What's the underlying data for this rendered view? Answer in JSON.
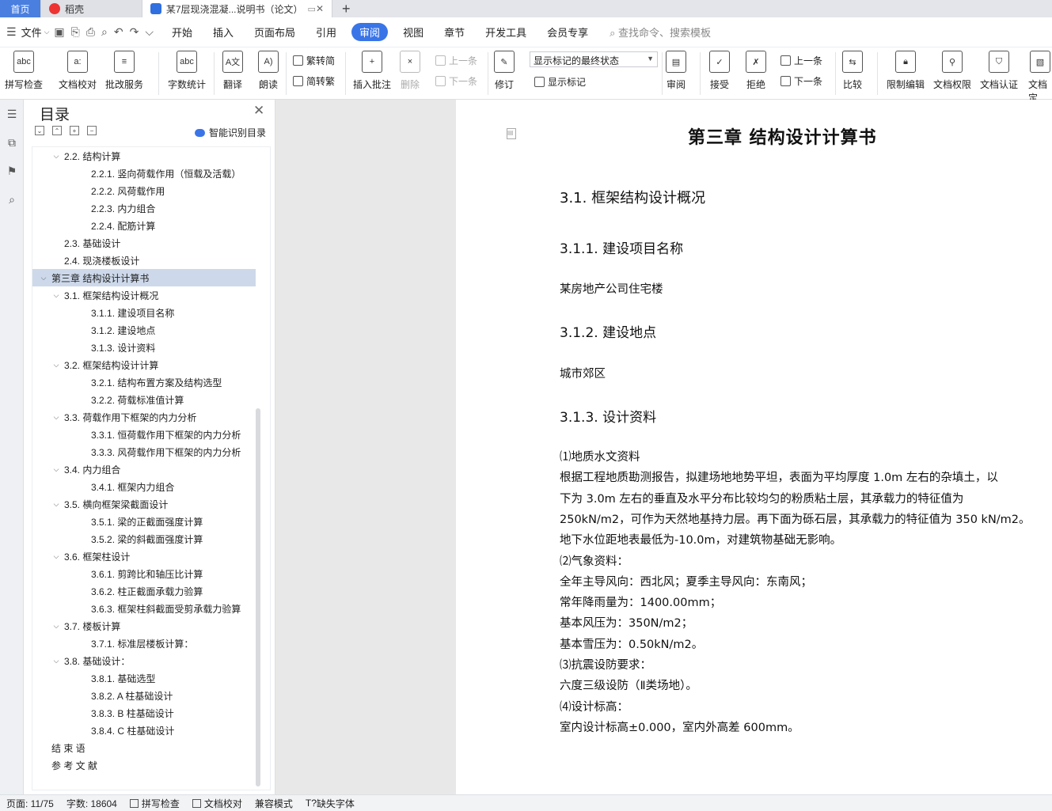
{
  "tabs": {
    "home": "首页",
    "daoke": "稻壳",
    "doc": "某7层现浇混凝...说明书（论文）",
    "plus": "+"
  },
  "menu": {
    "file": "文件",
    "items": [
      "开始",
      "插入",
      "页面布局",
      "引用",
      "审阅",
      "视图",
      "章节",
      "开发工具",
      "会员专享"
    ],
    "active": "审阅",
    "search": "查找命令、搜索模板"
  },
  "ribbon": {
    "spell": "拼写检查",
    "doccheck": "文档校对",
    "batch": "批改服务",
    "wordcount": "字数统计",
    "translate": "翻译",
    "read": "朗读",
    "t2s": "繁转简",
    "s2t": "简转繁",
    "insert_comment": "插入批注",
    "delete": "删除",
    "prev_comment": "上一条",
    "next_comment": "下一条",
    "track": "修订",
    "show_markup_select": "显示标记的最终状态",
    "show_markup": "显示标记",
    "review": "审阅",
    "accept": "接受",
    "reject": "拒绝",
    "prev": "上一条",
    "next": "下一条",
    "compare": "比较",
    "restrict": "限制编辑",
    "perm": "文档权限",
    "cert": "文档认证",
    "fin": "文档定"
  },
  "toc": {
    "title": "目录",
    "smart": "智能识别目录",
    "items": [
      {
        "text": "2.2.  结构计算",
        "lvl": 2,
        "chev": true
      },
      {
        "text": "2.2.1.  竖向荷载作用（恒载及活载）",
        "lvl": 3
      },
      {
        "text": "2.2.2.  风荷载作用",
        "lvl": 3
      },
      {
        "text": "2.2.3.  内力组合",
        "lvl": 3
      },
      {
        "text": "2.2.4.  配筋计算",
        "lvl": 3
      },
      {
        "text": "2.3.  基础设计",
        "lvl": 2
      },
      {
        "text": "2.4.  现浇楼板设计",
        "lvl": 2
      },
      {
        "text": "第三章    结构设计计算书",
        "lvl": 1,
        "chev": true,
        "sel": true
      },
      {
        "text": "3.1.  框架结构设计概况",
        "lvl": 2,
        "chev": true
      },
      {
        "text": "3.1.1.  建设项目名称",
        "lvl": 3
      },
      {
        "text": "3.1.2.  建设地点",
        "lvl": 3
      },
      {
        "text": "3.1.3.  设计资料",
        "lvl": 3
      },
      {
        "text": "3.2.  框架结构设计计算",
        "lvl": 2,
        "chev": true
      },
      {
        "text": "3.2.1.  结构布置方案及结构选型",
        "lvl": 3
      },
      {
        "text": "3.2.2.  荷载标准值计算",
        "lvl": 3
      },
      {
        "text": "3.3.  荷载作用下框架的内力分析",
        "lvl": 2,
        "chev": true
      },
      {
        "text": "3.3.1.  恒荷载作用下框架的内力分析",
        "lvl": 3
      },
      {
        "text": "3.3.3.  风荷载作用下框架的内力分析",
        "lvl": 3
      },
      {
        "text": "3.4.  内力组合",
        "lvl": 2,
        "chev": true
      },
      {
        "text": "3.4.1.  框架内力组合",
        "lvl": 3
      },
      {
        "text": "3.5.  横向框架梁截面设计",
        "lvl": 2,
        "chev": true
      },
      {
        "text": "3.5.1.  梁的正截面强度计算",
        "lvl": 3
      },
      {
        "text": "3.5.2.  梁的斜截面强度计算",
        "lvl": 3
      },
      {
        "text": "3.6.  框架柱设计",
        "lvl": 2,
        "chev": true
      },
      {
        "text": "3.6.1.  剪跨比和轴压比计算",
        "lvl": 3
      },
      {
        "text": "3.6.2.  柱正截面承载力验算",
        "lvl": 3
      },
      {
        "text": "3.6.3.  框架柱斜截面受剪承载力验算",
        "lvl": 3
      },
      {
        "text": "3.7.  楼板计算",
        "lvl": 2,
        "chev": true
      },
      {
        "text": "3.7.1.  标准层楼板计算：",
        "lvl": 3
      },
      {
        "text": "3.8.  基础设计：",
        "lvl": 2,
        "chev": true
      },
      {
        "text": "3.8.1.  基础选型",
        "lvl": 3
      },
      {
        "text": "3.8.2. A 柱基础设计",
        "lvl": 3
      },
      {
        "text": "3.8.3. B 柱基础设计",
        "lvl": 3
      },
      {
        "text": "3.8.4. C 柱基础设计",
        "lvl": 3
      },
      {
        "text": "结  束  语",
        "lvl": 1
      },
      {
        "text": "参  考  文  献",
        "lvl": 1
      }
    ]
  },
  "doc": {
    "h1": "第三章    结构设计计算书",
    "h2": "3.1.  框架结构设计概况",
    "h3a": "3.1.1.  建设项目名称",
    "pa": "某房地产公司住宅楼",
    "h3b": "3.1.2.  建设地点",
    "pb": "城市郊区",
    "h3c": "3.1.3.  设计资料",
    "lines": [
      "⑴地质水文资料",
      "根据工程地质勘测报告，拟建场地地势平坦，表面为平均厚度 1.0m 左右的杂填土，以",
      "下为 3.0m 左右的垂直及水平分布比较均匀的粉质粘土层，其承载力的特征值为",
      "250kN/m2，可作为天然地基持力层。再下面为砾石层，其承载力的特征值为 350 kN/m2。",
      "地下水位距地表最低为-10.0m，对建筑物基础无影响。",
      "⑵气象资料：",
      "全年主导风向：西北风；夏季主导风向：东南风；",
      "常年降雨量为：1400.00mm；",
      "基本风压为：350N/m2；",
      "基本雪压为：0.50kN/m2。",
      "⑶抗震设防要求：",
      "六度三级设防（Ⅱ类场地）。",
      "⑷设计标高：",
      "室内设计标高±0.000，室内外高差 600mm。"
    ]
  },
  "status": {
    "page": "页面: 11/75",
    "words": "字数: 18604",
    "spell": "拼写检查",
    "doccheck": "文档校对",
    "compat": "兼容模式",
    "font": "缺失字体"
  }
}
